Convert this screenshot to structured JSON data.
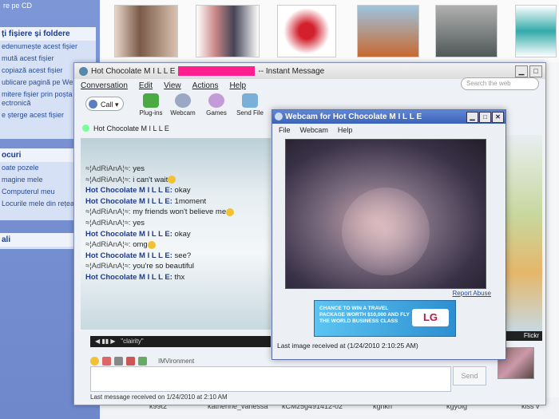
{
  "explorer": {
    "top_link": "re pe CD",
    "tasks_header": "ți fișiere și foldere",
    "tasks": [
      "edenumește acest fișier",
      "mută acest fișier",
      "copiază acest fișier",
      "ublicare pagină pe Web",
      "mitere fișier prin poșta ectronică",
      "e șterge acest fișier"
    ],
    "places_header": "ocuri",
    "places": [
      "oate pozele",
      "magine mele",
      "Computerul meu",
      "Locurile mele din rețea"
    ],
    "details_header": "ali",
    "filenames": [
      "k99t2",
      "katherine_vanessa",
      "kCMz5g491412-02",
      "kghkn",
      "kgyoig",
      "kiss v"
    ]
  },
  "im": {
    "title_prefix": "Hot Chocolate M I L L E",
    "title_suffix": "-- Instant Message",
    "menu": [
      "Conversation",
      "Edit",
      "View",
      "Actions",
      "Help"
    ],
    "search_placeholder": "Search the web",
    "toolbar": {
      "call": "Call",
      "plugins": "Plug-ins",
      "webcam": "Webcam",
      "games": "Games",
      "send_file": "Send File"
    },
    "contact": "Hot Chocolate M I L L E",
    "messages": [
      {
        "who": "≈¦AdRiAnA¦≈:",
        "text": "yes",
        "her": true
      },
      {
        "who": "≈¦AdRiAnA¦≈:",
        "text": "i can't wait",
        "her": true,
        "emo": true
      },
      {
        "who": "Hot Chocolate M I L L E:",
        "text": "okay",
        "her": false
      },
      {
        "who": "Hot Chocolate M I L L E:",
        "text": "1moment",
        "her": false
      },
      {
        "who": "≈¦AdRiAnA¦≈:",
        "text": "my friends won't believe me",
        "her": true,
        "emo": true
      },
      {
        "who": "≈¦AdRiAnA¦≈:",
        "text": "yes",
        "her": true
      },
      {
        "who": "Hot Chocolate M I L L E:",
        "text": "okay",
        "her": false
      },
      {
        "who": "≈¦AdRiAnA¦≈:",
        "text": "omg",
        "her": true,
        "emo": true
      },
      {
        "who": "Hot Chocolate M I L L E:",
        "text": "see?",
        "her": false
      },
      {
        "who": "≈¦AdRiAnA¦≈:",
        "text": "you're so beautiful",
        "her": true
      },
      {
        "who": "Hot Chocolate M I L L E:",
        "text": "thx",
        "her": false
      }
    ],
    "video_label": "\"clairity\"",
    "environment_label": "IMVironment",
    "send": "Send",
    "status": "Last message received on 1/24/2010 at 2:10 AM",
    "flickr": "Flickr"
  },
  "webcam": {
    "title": "Webcam for Hot Chocolate M I L L E",
    "menu": [
      "File",
      "Webcam",
      "Help"
    ],
    "report": "Report Abuse",
    "ad_text": "Chance to win a travel package worth $10,000 and fly the world business class",
    "ad_logo": "LG",
    "status": "Last image received at (1/24/2010 2:10:25 AM)"
  },
  "colors": {
    "redaction": "#ff1f8e",
    "webcam_title": "#3b63b8"
  }
}
